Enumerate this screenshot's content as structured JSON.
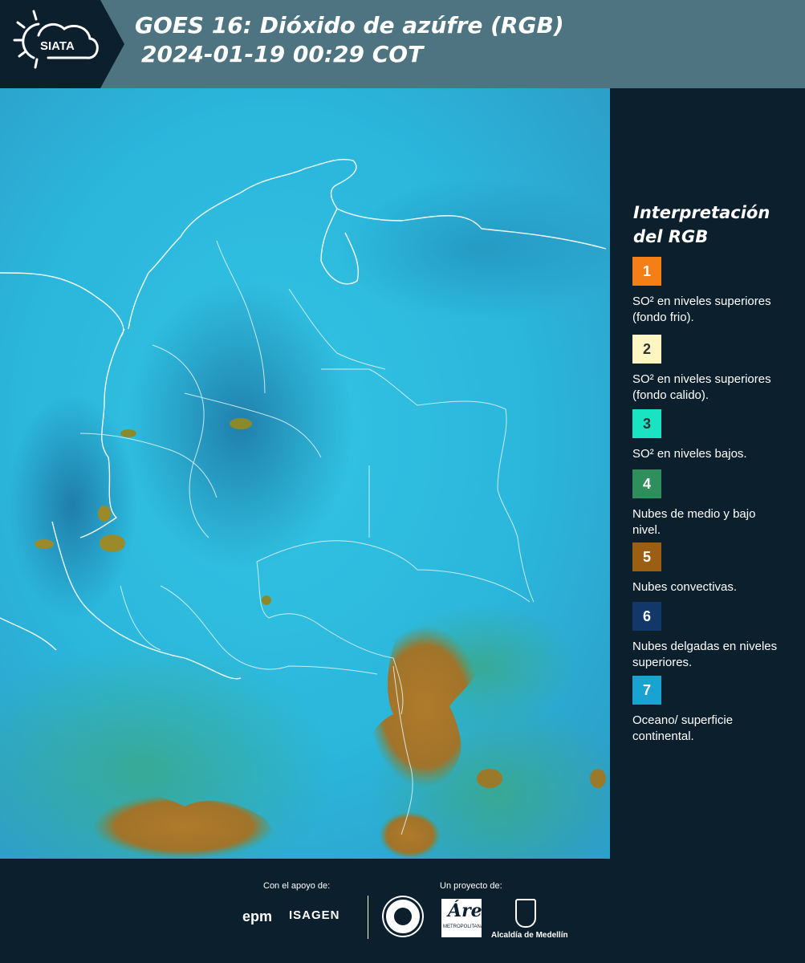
{
  "header": {
    "logo_text": "SIATA",
    "title_line1": "GOES 16: Dióxido de azúfre (RGB)",
    "title_line2": "2024-01-19 00:29 COT"
  },
  "legend": {
    "title": "Interpretación del RGB",
    "items": [
      {
        "number": "1",
        "color": "#f57f17",
        "number_color": "#ffffff",
        "text": "SO² en niveles superiores (fondo frio)."
      },
      {
        "number": "2",
        "color": "#fdf5c2",
        "number_color": "#333333",
        "text": "SO² en niveles superiores (fondo calido)."
      },
      {
        "number": "3",
        "color": "#19e3c3",
        "number_color": "#333333",
        "text": "SO² en niveles bajos."
      },
      {
        "number": "4",
        "color": "#2f8f5c",
        "number_color": "#ffffff",
        "text": "Nubes de medio y bajo nivel."
      },
      {
        "number": "5",
        "color": "#9a5f12",
        "number_color": "#ffffff",
        "text": "Nubes convectivas."
      },
      {
        "number": "6",
        "color": "#123769",
        "number_color": "#ffffff",
        "text": "Nubes delgadas en niveles superiores."
      },
      {
        "number": "7",
        "color": "#1aa3d0",
        "number_color": "#ffffff",
        "text": "Oceano/ superficie continental."
      }
    ]
  },
  "footer": {
    "support_label": "Con el apoyo de:",
    "project_label": "Un proyecto de:",
    "sponsor1": "epm",
    "sponsor2": "ISAGEN",
    "area_logo_text": "Área",
    "area_logo_subtext": "METROPOLITANA",
    "alcaldia_label": "Alcaldía de Medellín"
  }
}
